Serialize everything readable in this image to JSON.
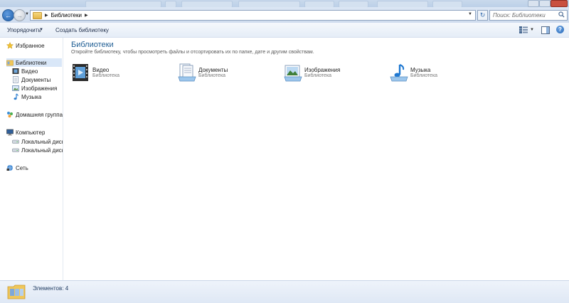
{
  "address": {
    "path": [
      "Библиотеки"
    ],
    "search_placeholder": "Поиск: Библиотеки"
  },
  "toolbar": {
    "organize_label": "Упорядочить",
    "create_library_label": "Создать библиотеку"
  },
  "sidebar": {
    "favorites": "Избранное",
    "libraries": "Библиотеки",
    "library_items": [
      "Видео",
      "Документы",
      "Изображения",
      "Музыка"
    ],
    "homegroup": "Домашняя группа",
    "computer": "Компьютер",
    "drives": [
      "Локальный диск (",
      "Локальный диск ("
    ],
    "network": "Сеть"
  },
  "main": {
    "title": "Библиотеки",
    "description": "Откройте библиотеку, чтобы просмотреть файлы и отсортировать их по папке, дате и другим свойствам.",
    "libraries": [
      {
        "name": "Видео",
        "type": "Библиотека",
        "icon": "video-library-icon"
      },
      {
        "name": "Документы",
        "type": "Библиотека",
        "icon": "documents-library-icon"
      },
      {
        "name": "Изображения",
        "type": "Библиотека",
        "icon": "pictures-library-icon"
      },
      {
        "name": "Музыка",
        "type": "Библиотека",
        "icon": "music-library-icon"
      }
    ]
  },
  "status": {
    "items_count": "Элементов: 4"
  },
  "colors": {
    "title_blue": "#1e5d93",
    "selection": "#d9e7f8",
    "folder_yellow": "#f0c75a"
  }
}
